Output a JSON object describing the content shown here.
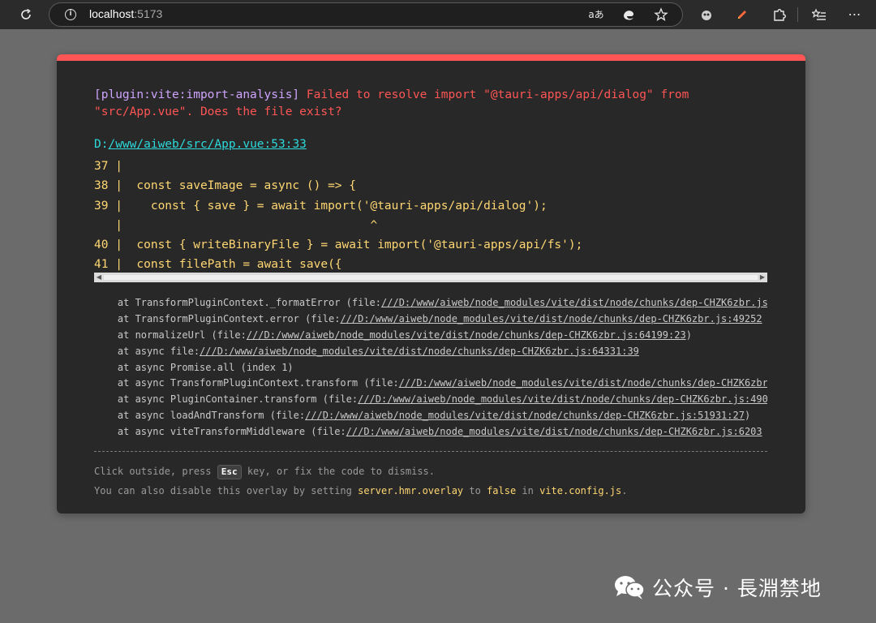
{
  "browser": {
    "url_host": "localhost",
    "url_port": ":5173",
    "info_icon": "i",
    "read_aloud_label": "aあ"
  },
  "overlay": {
    "accent_color": "#ff5555",
    "plugin": "[plugin:vite:import-analysis]",
    "message": " Failed to resolve import \"@tauri-apps/api/dialog\" from\n\"src/App.vue\". Does the file exist?",
    "file_prefix": "D:",
    "file_path": "/www/aiweb/src/App.vue:53:33",
    "code_frame": [
      "37 |",
      "38 |  const saveImage = async () => {",
      "39 |    const { save } = await import('@tauri-apps/api/dialog');",
      "   |                                   ^",
      "40 |  const { writeBinaryFile } = await import('@tauri-apps/api/fs');",
      "41 |  const filePath = await save({"
    ],
    "stack": [
      {
        "pre": "    at TransformPluginContext._formatError (file:",
        "url": "///D:/www/aiweb/node_modules/vite/dist/node/chunks/dep-CHZK6zbr.js"
      },
      {
        "pre": "    at TransformPluginContext.error (file:",
        "url": "///D:/www/aiweb/node_modules/vite/dist/node/chunks/dep-CHZK6zbr.js:49252"
      },
      {
        "pre": "    at normalizeUrl (file:",
        "url": "///D:/www/aiweb/node_modules/vite/dist/node/chunks/dep-CHZK6zbr.js:64199:23",
        "post": ")"
      },
      {
        "pre": "    at async file:",
        "url": "///D:/www/aiweb/node_modules/vite/dist/node/chunks/dep-CHZK6zbr.js:64331:39"
      },
      {
        "pre": "    at async Promise.all (index 1)",
        "url": ""
      },
      {
        "pre": "    at async TransformPluginContext.transform (file:",
        "url": "///D:/www/aiweb/node_modules/vite/dist/node/chunks/dep-CHZK6zbr"
      },
      {
        "pre": "    at async PluginContainer.transform (file:",
        "url": "///D:/www/aiweb/node_modules/vite/dist/node/chunks/dep-CHZK6zbr.js:490"
      },
      {
        "pre": "    at async loadAndTransform (file:",
        "url": "///D:/www/aiweb/node_modules/vite/dist/node/chunks/dep-CHZK6zbr.js:51931:27",
        "post": ")"
      },
      {
        "pre": "    at async viteTransformMiddleware (file:",
        "url": "///D:/www/aiweb/node_modules/vite/dist/node/chunks/dep-CHZK6zbr.js:6203"
      }
    ],
    "tip1_a": "Click outside, press ",
    "tip1_key": "Esc",
    "tip1_b": " key, or fix the code to dismiss.",
    "tip2_a": "You can also disable this overlay by setting ",
    "tip2_setting": "server.hmr.overlay",
    "tip2_b": " to ",
    "tip2_value": "false",
    "tip2_c": " in ",
    "tip2_file": "vite.config.js",
    "tip2_d": "."
  },
  "watermark": {
    "text": "公众号 · 長淵禁地"
  }
}
